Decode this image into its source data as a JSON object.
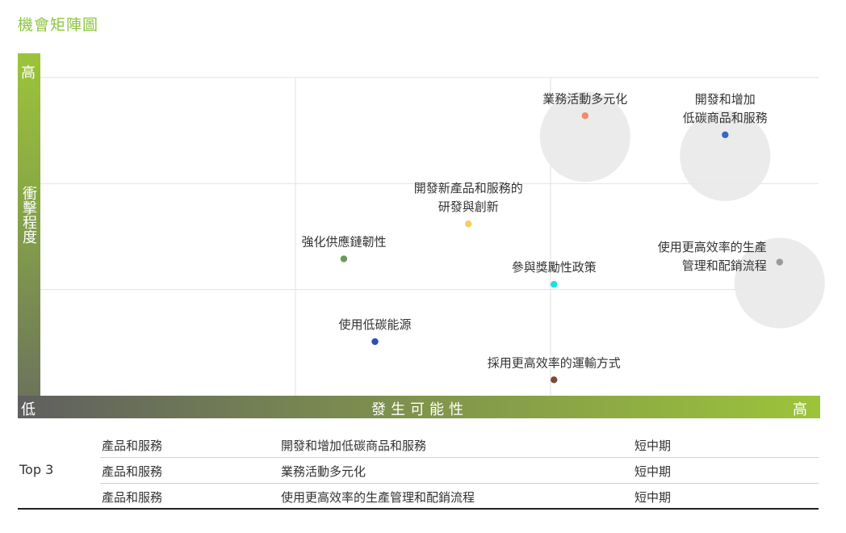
{
  "page": {
    "title": "機會矩陣圖"
  },
  "chart_data": {
    "type": "scatter",
    "title": "",
    "xlabel": "發生可能性",
    "ylabel": "衝擊程度",
    "x_low_label": "低",
    "x_high_label": "高",
    "y_high_label": "高",
    "xlim": [
      0,
      1
    ],
    "ylim": [
      0,
      1
    ],
    "grid": true,
    "highlighted": [
      "開發和增加低碳商品和服務",
      "業務活動多元化",
      "使用更高效率的生產管理和配銷流程"
    ],
    "points": [
      {
        "label_lines": [
          "業務活動多元化"
        ],
        "x": 0.7,
        "y": 0.88,
        "color": "#f28b6b",
        "highlight": true
      },
      {
        "label_lines": [
          "開發和增加",
          "低碳商品和服務"
        ],
        "x": 0.88,
        "y": 0.82,
        "color": "#3a66c4",
        "highlight": true
      },
      {
        "label_lines": [
          "開發新產品和服務的",
          "研發與創新"
        ],
        "x": 0.55,
        "y": 0.54,
        "color": "#f7cd5e",
        "highlight": false
      },
      {
        "label_lines": [
          "強化供應鏈韌性"
        ],
        "x": 0.39,
        "y": 0.43,
        "color": "#6a9a5a",
        "highlight": false
      },
      {
        "label_lines": [
          "參與獎勵性政策"
        ],
        "x": 0.66,
        "y": 0.35,
        "color": "#18e0e8",
        "highlight": false
      },
      {
        "label_lines": [
          "使用更高效率的生產",
          "管理和配銷流程"
        ],
        "x": 0.95,
        "y": 0.42,
        "color": "#9a9a9a",
        "highlight": true
      },
      {
        "label_lines": [
          "使用低碳能源"
        ],
        "x": 0.43,
        "y": 0.17,
        "color": "#2d4fb4",
        "highlight": false
      },
      {
        "label_lines": [
          "採用更高效率的運輸方式"
        ],
        "x": 0.66,
        "y": 0.05,
        "color": "#7a4a3a",
        "highlight": false
      }
    ]
  },
  "table": {
    "group_label": "Top 3",
    "rows": [
      {
        "category": "產品和服務",
        "item": "開發和增加低碳商品和服務",
        "term": "短中期"
      },
      {
        "category": "產品和服務",
        "item": "業務活動多元化",
        "term": "短中期"
      },
      {
        "category": "產品和服務",
        "item": "使用更高效率的生產管理和配銷流程",
        "term": "短中期"
      }
    ]
  }
}
